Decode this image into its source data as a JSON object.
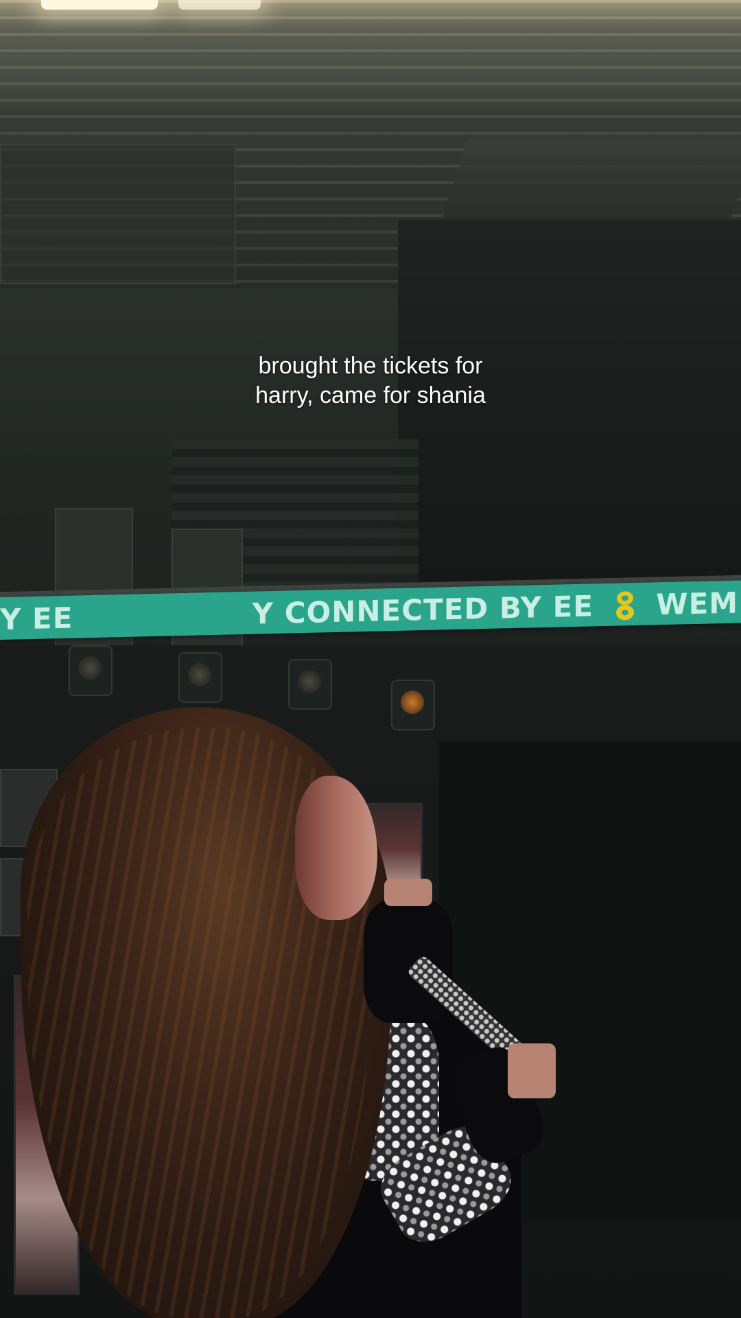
{
  "caption": {
    "line1": "brought the tickets for",
    "line2": "harry, came for shania"
  },
  "banner": {
    "text_left": "Y EE",
    "text_right": "Y CONNECTED BY EE",
    "text_end": "WEMBLEY",
    "color": "#2aa48a",
    "logo_color": "#e6c619"
  }
}
